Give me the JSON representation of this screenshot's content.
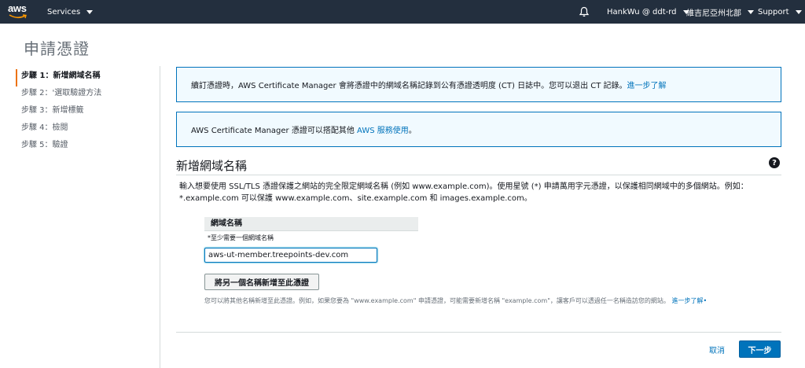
{
  "nav": {
    "logo": "aws",
    "services": "Services",
    "user": "HankWu @ ddt-rd",
    "region": "維吉尼亞州北部",
    "support": "Support"
  },
  "page": {
    "title": "申請憑證"
  },
  "steps": [
    "步驟 1：新增網域名稱",
    "步驟 2：'選取驗證方法",
    "步驟 3：新增標籤",
    "步驟 4：檢閱",
    "步驟 5：驗證"
  ],
  "info1": {
    "text": "續訂憑證時，AWS Certificate Manager 會將憑證中的網域名稱記錄到公有憑證透明度 (CT) 日誌中。您可以退出 CT 記錄。",
    "link": "進一步了解"
  },
  "info2": {
    "text": "AWS Certificate Manager 憑證可以搭配其他 ",
    "link": "AWS 服務使用",
    "suffix": "。"
  },
  "section": {
    "title": "新增網域名稱",
    "help": "?",
    "description": "輸入想要使用 SSL/TLS 憑證保護之網站的完全限定網域名稱 (例如 www.example.com)。使用星號 (*) 申請萬用字元憑證，以保護相同網域中的多個網站。例如：*.example.com 可以保護 www.example.com、site.example.com 和 images.example.com。"
  },
  "field": {
    "header": "網域名稱",
    "hint": "*至少需要一個網域名稱",
    "value": "aws-ut-member.treepoints-dev.com"
  },
  "add_button": "將另一個名稱新增至此憑證",
  "add_hint": {
    "text": "您可以將其他名稱新增至此憑證。例如，如果您要為 \"www.example.com\" 申請憑證，可能需要新增名稱 \"example.com\"，讓客戶可以透過任一名稱造訪您的網站。",
    "link": "進一步了解"
  },
  "footer": {
    "cancel": "取消",
    "next": "下一步"
  },
  "colors": {
    "nav_bg": "#232f3e",
    "accent": "#ec7211",
    "link": "#0073bb",
    "info_bg": "#f1faff"
  }
}
